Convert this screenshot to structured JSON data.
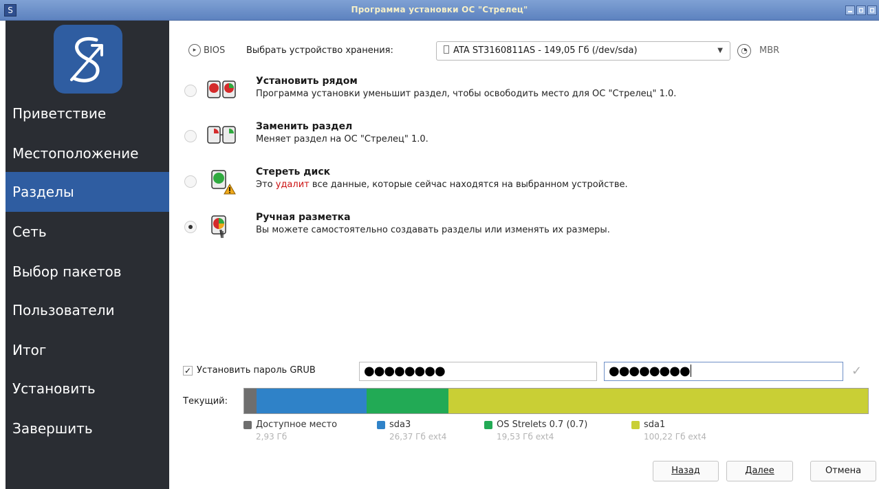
{
  "window": {
    "title": "Программа установки ОС \"Стрелец\"",
    "app_icon_glyph": "S"
  },
  "sidebar": {
    "items": [
      {
        "label": "Приветствие"
      },
      {
        "label": "Местоположение"
      },
      {
        "label": "Разделы",
        "active": true
      },
      {
        "label": "Сеть"
      },
      {
        "label": "Выбор пакетов"
      },
      {
        "label": "Пользователи"
      },
      {
        "label": "Итог"
      },
      {
        "label": "Установить"
      },
      {
        "label": "Завершить"
      }
    ]
  },
  "storage": {
    "bios_label": "BIOS",
    "select_label": "Выбрать устройство хранения:",
    "device_value": "ATA ST3160811AS - 149,05 Гб (/dev/sda)",
    "mbr_label": "MBR"
  },
  "options": [
    {
      "title": "Установить рядом",
      "desc": "Программа установки уменьшит раздел, чтобы освободить место для ОС \"Стрелец\" 1.0.",
      "checked": false
    },
    {
      "title": "Заменить раздел",
      "desc": "Меняет раздел на ОС \"Стрелец\" 1.0.",
      "checked": false
    },
    {
      "title": "Стереть диск",
      "desc_prefix": "Это ",
      "desc_danger": "удалит",
      "desc_suffix": " все данные, которые сейчас находятся на выбранном устройстве.",
      "checked": false
    },
    {
      "title": "Ручная разметка",
      "desc": "Вы можете самостоятельно создавать разделы или изменять их размеры.",
      "checked": true
    }
  ],
  "grub": {
    "checkbox_checked": true,
    "label": "Установить пароль GRUB",
    "password1": "●●●●●●●●",
    "password2": "●●●●●●●●"
  },
  "partitions": {
    "current_label": "Текущий:",
    "segments": [
      {
        "name": "Доступное место",
        "size": "2,93 Гб",
        "fs": "",
        "color": "#6e6e6e",
        "value_gb": 2.93
      },
      {
        "name": "sda3",
        "size": "26,37 Гб",
        "fs": "ext4",
        "color": "#2f82c8",
        "value_gb": 26.37
      },
      {
        "name": "OS Strelets 0.7 (0.7)",
        "size": "19,53 Гб",
        "fs": "ext4",
        "color": "#22aa55",
        "value_gb": 19.53
      },
      {
        "name": "sda1",
        "size": "100,22 Гб",
        "fs": "ext4",
        "color": "#c9cf35",
        "value_gb": 100.22
      }
    ]
  },
  "buttons": {
    "back": "Назад",
    "next": "Далее",
    "cancel": "Отмена"
  }
}
